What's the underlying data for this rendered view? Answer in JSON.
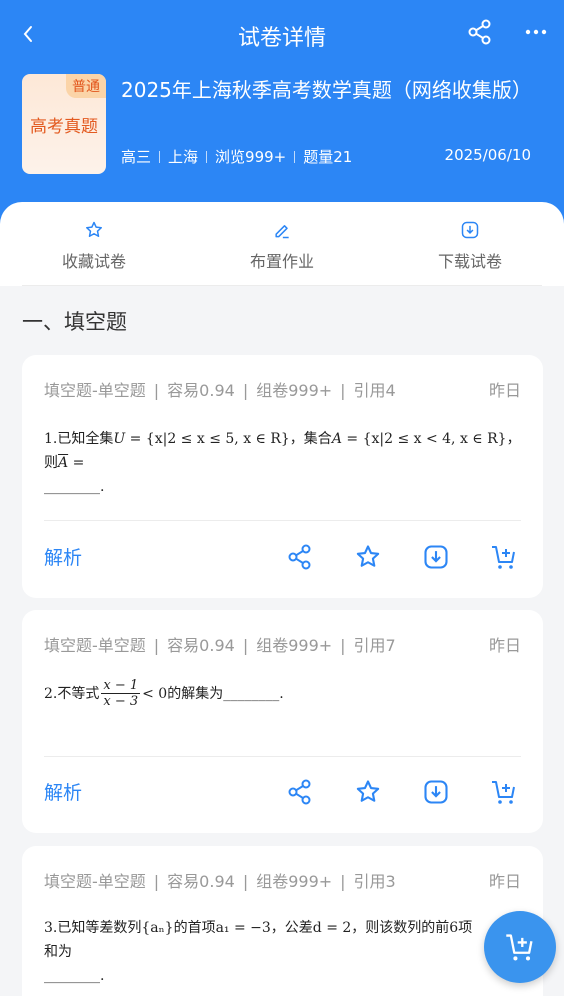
{
  "header": {
    "title": "试卷详情",
    "cover_tag": "普通",
    "cover_text": "高考真题",
    "paper_title": "2025年上海秋季高考数学真题（网络收集版）",
    "meta": [
      "高三",
      "上海",
      "浏览999+",
      "题量21"
    ],
    "date": "2025/06/10",
    "bg_color": "#2c86f5"
  },
  "actions": [
    "收藏试卷",
    "布置作业",
    "下载试卷"
  ],
  "section_title": "一、填空题",
  "questions": [
    {
      "type": "填空题-单空题",
      "difficulty": "容易0.94",
      "zujuan": "组卷999+",
      "cite": "引用4",
      "when": "昨日",
      "text_a": "1.已知全集",
      "text_b": "U",
      "text_c": " = {x|2 ≤ x ≤ 5, x ∈ R}，集合",
      "text_d": "A",
      "text_e": " = {x|2 ≤ x < 4, x ∈ R}，则",
      "text_f": "A",
      "text_g": " =",
      "blank": "________.",
      "jiexi": "解析"
    },
    {
      "type": "填空题-单空题",
      "difficulty": "容易0.94",
      "zujuan": "组卷999+",
      "cite": "引用7",
      "when": "昨日",
      "prefix": "2.不等式",
      "num": "x − 1",
      "den": "x − 3",
      "suffix": " < 0的解集为________.",
      "jiexi": "解析"
    },
    {
      "type": "填空题-单空题",
      "difficulty": "容易0.94",
      "zujuan": "组卷999+",
      "cite": "引用3",
      "when": "昨日",
      "text": "3.已知等差数列{aₙ}的首项a₁ = −3，公差d = 2，则该数列的前6项和为",
      "blank": "________."
    }
  ]
}
